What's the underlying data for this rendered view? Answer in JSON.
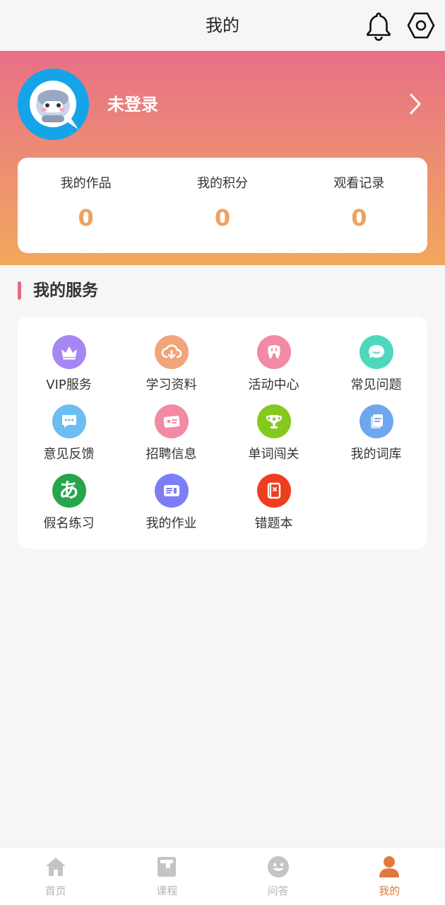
{
  "header": {
    "title": "我的",
    "bell_icon": "bell-icon",
    "settings_icon": "settings-hex-icon"
  },
  "profile": {
    "login_text": "未登录",
    "avatar_icon": "avatar-character-icon",
    "chevron_icon": "chevron-right-icon"
  },
  "stats": [
    {
      "label": "我的作品",
      "value": "0"
    },
    {
      "label": "我的积分",
      "value": "0"
    },
    {
      "label": "观看记录",
      "value": "0"
    }
  ],
  "services": {
    "title": "我的服务",
    "items": [
      {
        "label": "VIP服务",
        "icon": "crown-icon",
        "color": "#a686f2"
      },
      {
        "label": "学习资料",
        "icon": "cloud-download-icon",
        "color": "#f1a57a"
      },
      {
        "label": "活动中心",
        "icon": "tooth-icon",
        "color": "#f28aa3"
      },
      {
        "label": "常见问题",
        "icon": "question-bubble-icon",
        "color": "#4fd7be"
      },
      {
        "label": "意见反馈",
        "icon": "chat-bubble-icon",
        "color": "#6cbdf2"
      },
      {
        "label": "招聘信息",
        "icon": "id-card-icon",
        "color": "#f28aa3"
      },
      {
        "label": "单词闯关",
        "icon": "trophy-icon",
        "color": "#86c91e"
      },
      {
        "label": "我的词库",
        "icon": "cards-icon",
        "color": "#6ea7ee"
      },
      {
        "label": "假名练习",
        "icon": "kana-icon",
        "color": "#26a64a",
        "glyph": "あ"
      },
      {
        "label": "我的作业",
        "icon": "homework-icon",
        "color": "#7c7ef5"
      },
      {
        "label": "错题本",
        "icon": "error-book-icon",
        "color": "#ef3d1f"
      }
    ]
  },
  "tabbar": [
    {
      "label": "首页",
      "icon": "home-icon",
      "active": false
    },
    {
      "label": "课程",
      "icon": "course-book-icon",
      "active": false
    },
    {
      "label": "问答",
      "icon": "qa-smile-icon",
      "active": false
    },
    {
      "label": "我的",
      "icon": "person-icon",
      "active": true
    }
  ],
  "colors": {
    "accent": "#e07a3c",
    "stat_value": "#eea162",
    "gradient_top": "#e86f86",
    "gradient_bottom": "#f2a75c"
  }
}
